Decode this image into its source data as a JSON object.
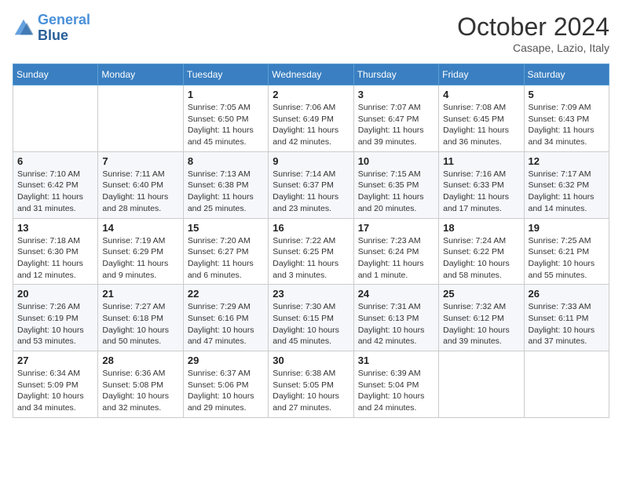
{
  "header": {
    "logo_line1": "General",
    "logo_line2": "Blue",
    "month": "October 2024",
    "location": "Casape, Lazio, Italy"
  },
  "weekdays": [
    "Sunday",
    "Monday",
    "Tuesday",
    "Wednesday",
    "Thursday",
    "Friday",
    "Saturday"
  ],
  "weeks": [
    [
      {
        "day": "",
        "sunrise": "",
        "sunset": "",
        "daylight": ""
      },
      {
        "day": "",
        "sunrise": "",
        "sunset": "",
        "daylight": ""
      },
      {
        "day": "1",
        "sunrise": "Sunrise: 7:05 AM",
        "sunset": "Sunset: 6:50 PM",
        "daylight": "Daylight: 11 hours and 45 minutes."
      },
      {
        "day": "2",
        "sunrise": "Sunrise: 7:06 AM",
        "sunset": "Sunset: 6:49 PM",
        "daylight": "Daylight: 11 hours and 42 minutes."
      },
      {
        "day": "3",
        "sunrise": "Sunrise: 7:07 AM",
        "sunset": "Sunset: 6:47 PM",
        "daylight": "Daylight: 11 hours and 39 minutes."
      },
      {
        "day": "4",
        "sunrise": "Sunrise: 7:08 AM",
        "sunset": "Sunset: 6:45 PM",
        "daylight": "Daylight: 11 hours and 36 minutes."
      },
      {
        "day": "5",
        "sunrise": "Sunrise: 7:09 AM",
        "sunset": "Sunset: 6:43 PM",
        "daylight": "Daylight: 11 hours and 34 minutes."
      }
    ],
    [
      {
        "day": "6",
        "sunrise": "Sunrise: 7:10 AM",
        "sunset": "Sunset: 6:42 PM",
        "daylight": "Daylight: 11 hours and 31 minutes."
      },
      {
        "day": "7",
        "sunrise": "Sunrise: 7:11 AM",
        "sunset": "Sunset: 6:40 PM",
        "daylight": "Daylight: 11 hours and 28 minutes."
      },
      {
        "day": "8",
        "sunrise": "Sunrise: 7:13 AM",
        "sunset": "Sunset: 6:38 PM",
        "daylight": "Daylight: 11 hours and 25 minutes."
      },
      {
        "day": "9",
        "sunrise": "Sunrise: 7:14 AM",
        "sunset": "Sunset: 6:37 PM",
        "daylight": "Daylight: 11 hours and 23 minutes."
      },
      {
        "day": "10",
        "sunrise": "Sunrise: 7:15 AM",
        "sunset": "Sunset: 6:35 PM",
        "daylight": "Daylight: 11 hours and 20 minutes."
      },
      {
        "day": "11",
        "sunrise": "Sunrise: 7:16 AM",
        "sunset": "Sunset: 6:33 PM",
        "daylight": "Daylight: 11 hours and 17 minutes."
      },
      {
        "day": "12",
        "sunrise": "Sunrise: 7:17 AM",
        "sunset": "Sunset: 6:32 PM",
        "daylight": "Daylight: 11 hours and 14 minutes."
      }
    ],
    [
      {
        "day": "13",
        "sunrise": "Sunrise: 7:18 AM",
        "sunset": "Sunset: 6:30 PM",
        "daylight": "Daylight: 11 hours and 12 minutes."
      },
      {
        "day": "14",
        "sunrise": "Sunrise: 7:19 AM",
        "sunset": "Sunset: 6:29 PM",
        "daylight": "Daylight: 11 hours and 9 minutes."
      },
      {
        "day": "15",
        "sunrise": "Sunrise: 7:20 AM",
        "sunset": "Sunset: 6:27 PM",
        "daylight": "Daylight: 11 hours and 6 minutes."
      },
      {
        "day": "16",
        "sunrise": "Sunrise: 7:22 AM",
        "sunset": "Sunset: 6:25 PM",
        "daylight": "Daylight: 11 hours and 3 minutes."
      },
      {
        "day": "17",
        "sunrise": "Sunrise: 7:23 AM",
        "sunset": "Sunset: 6:24 PM",
        "daylight": "Daylight: 11 hours and 1 minute."
      },
      {
        "day": "18",
        "sunrise": "Sunrise: 7:24 AM",
        "sunset": "Sunset: 6:22 PM",
        "daylight": "Daylight: 10 hours and 58 minutes."
      },
      {
        "day": "19",
        "sunrise": "Sunrise: 7:25 AM",
        "sunset": "Sunset: 6:21 PM",
        "daylight": "Daylight: 10 hours and 55 minutes."
      }
    ],
    [
      {
        "day": "20",
        "sunrise": "Sunrise: 7:26 AM",
        "sunset": "Sunset: 6:19 PM",
        "daylight": "Daylight: 10 hours and 53 minutes."
      },
      {
        "day": "21",
        "sunrise": "Sunrise: 7:27 AM",
        "sunset": "Sunset: 6:18 PM",
        "daylight": "Daylight: 10 hours and 50 minutes."
      },
      {
        "day": "22",
        "sunrise": "Sunrise: 7:29 AM",
        "sunset": "Sunset: 6:16 PM",
        "daylight": "Daylight: 10 hours and 47 minutes."
      },
      {
        "day": "23",
        "sunrise": "Sunrise: 7:30 AM",
        "sunset": "Sunset: 6:15 PM",
        "daylight": "Daylight: 10 hours and 45 minutes."
      },
      {
        "day": "24",
        "sunrise": "Sunrise: 7:31 AM",
        "sunset": "Sunset: 6:13 PM",
        "daylight": "Daylight: 10 hours and 42 minutes."
      },
      {
        "day": "25",
        "sunrise": "Sunrise: 7:32 AM",
        "sunset": "Sunset: 6:12 PM",
        "daylight": "Daylight: 10 hours and 39 minutes."
      },
      {
        "day": "26",
        "sunrise": "Sunrise: 7:33 AM",
        "sunset": "Sunset: 6:11 PM",
        "daylight": "Daylight: 10 hours and 37 minutes."
      }
    ],
    [
      {
        "day": "27",
        "sunrise": "Sunrise: 6:34 AM",
        "sunset": "Sunset: 5:09 PM",
        "daylight": "Daylight: 10 hours and 34 minutes."
      },
      {
        "day": "28",
        "sunrise": "Sunrise: 6:36 AM",
        "sunset": "Sunset: 5:08 PM",
        "daylight": "Daylight: 10 hours and 32 minutes."
      },
      {
        "day": "29",
        "sunrise": "Sunrise: 6:37 AM",
        "sunset": "Sunset: 5:06 PM",
        "daylight": "Daylight: 10 hours and 29 minutes."
      },
      {
        "day": "30",
        "sunrise": "Sunrise: 6:38 AM",
        "sunset": "Sunset: 5:05 PM",
        "daylight": "Daylight: 10 hours and 27 minutes."
      },
      {
        "day": "31",
        "sunrise": "Sunrise: 6:39 AM",
        "sunset": "Sunset: 5:04 PM",
        "daylight": "Daylight: 10 hours and 24 minutes."
      },
      {
        "day": "",
        "sunrise": "",
        "sunset": "",
        "daylight": ""
      },
      {
        "day": "",
        "sunrise": "",
        "sunset": "",
        "daylight": ""
      }
    ]
  ]
}
